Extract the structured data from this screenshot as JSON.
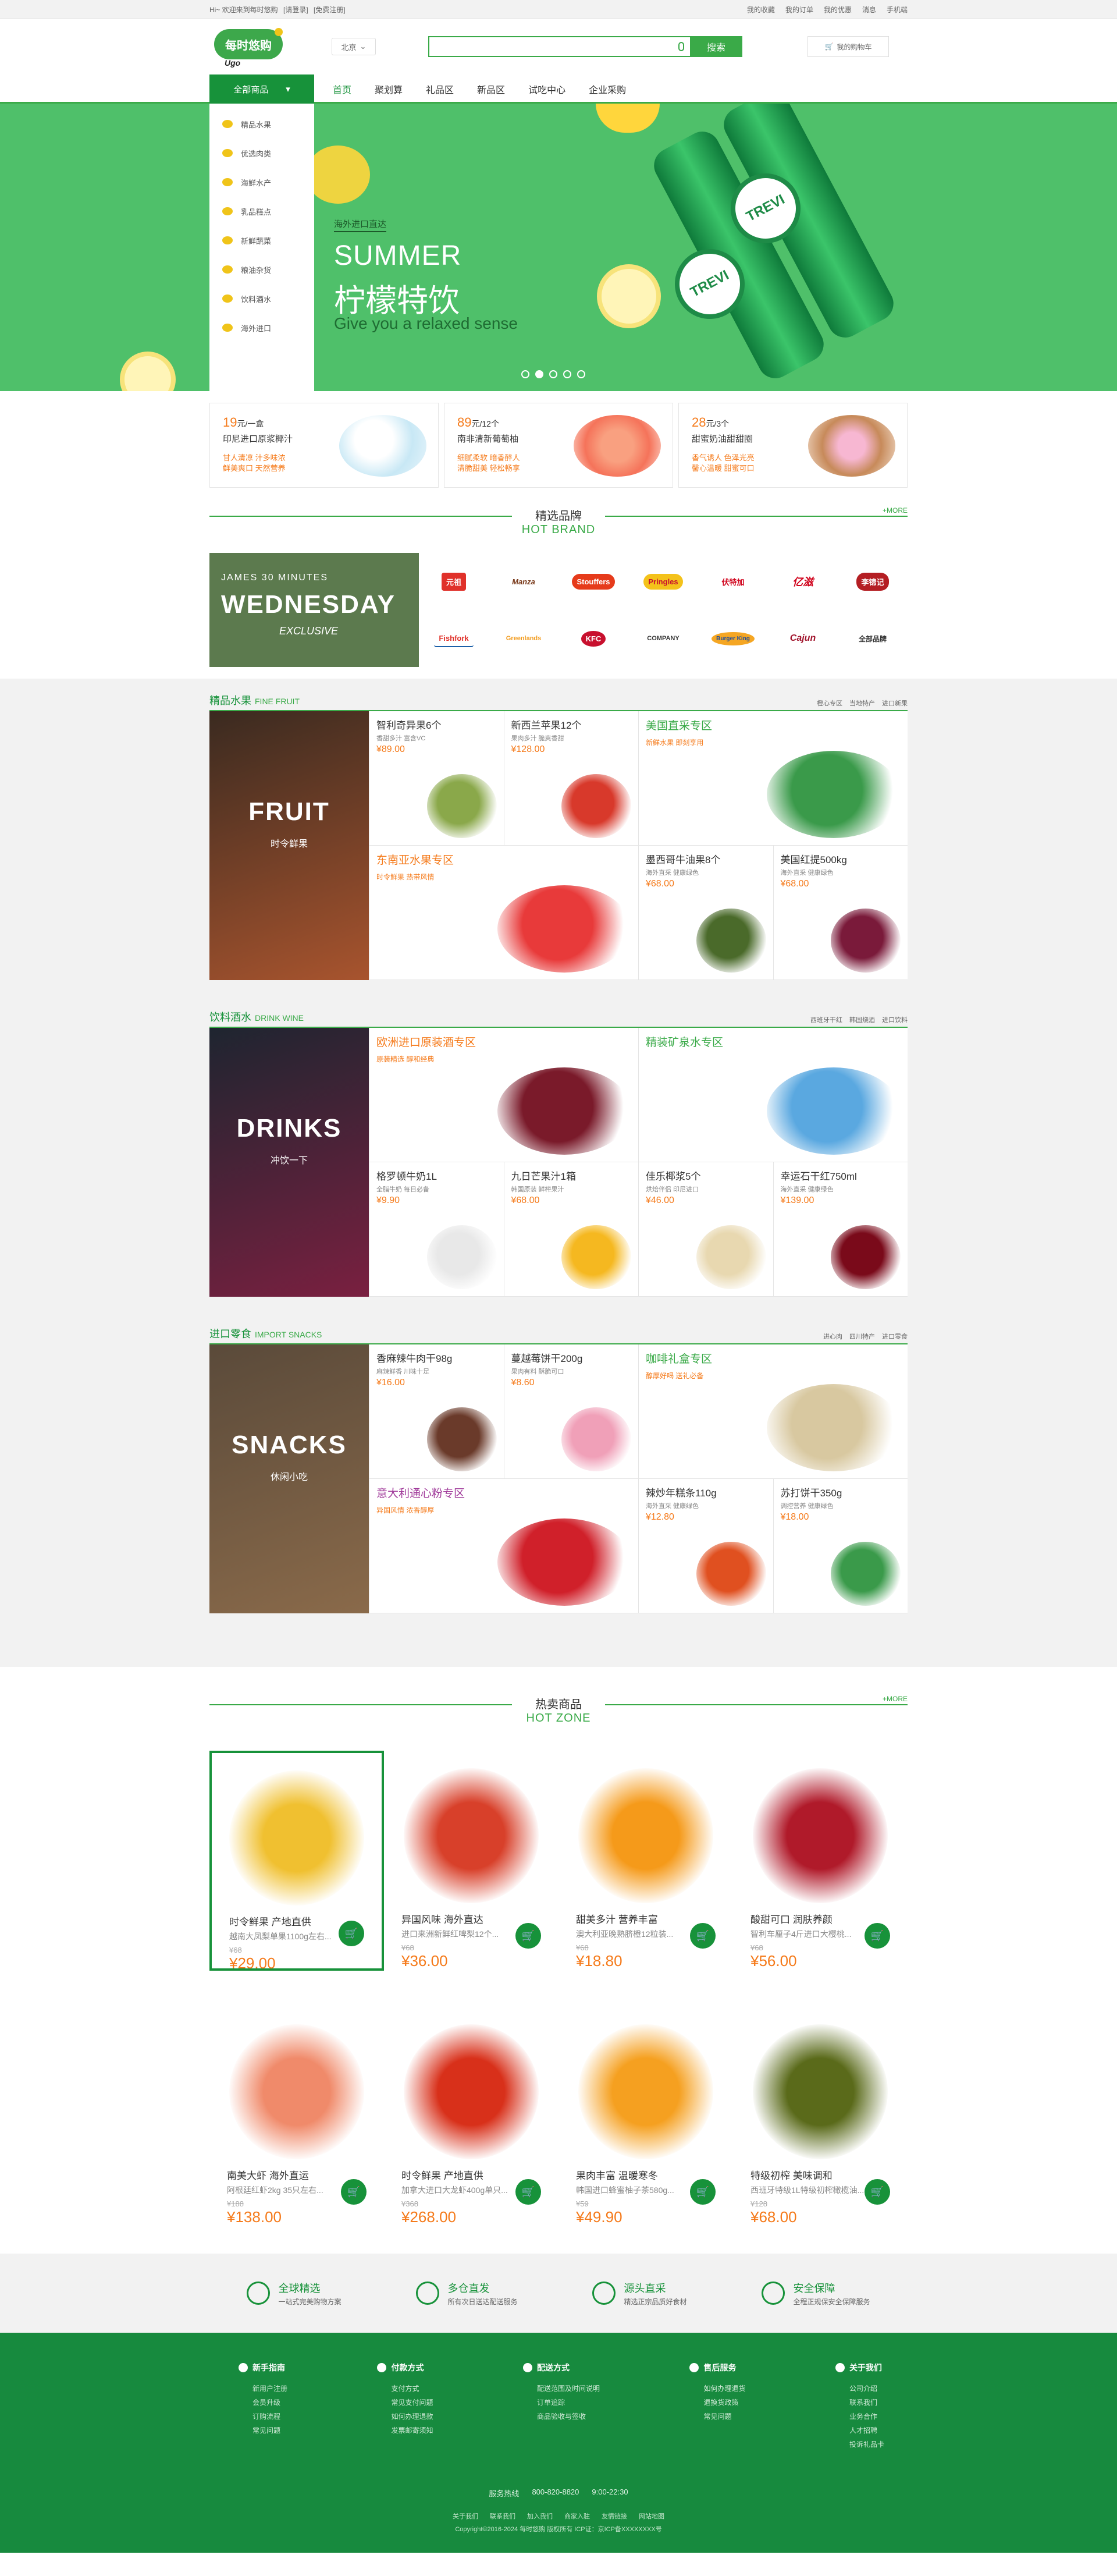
{
  "topbar": {
    "welcome": "Hi~ 欢迎来到每时悠购",
    "login": "[请登录]",
    "register": "[免费注册]",
    "links": [
      "我的收藏",
      "我的订单",
      "我的优惠",
      "消息",
      "手机端"
    ]
  },
  "header": {
    "logo_cn": "每时悠购",
    "logo_en": "Ugo",
    "city": "北京",
    "search_placeholder": "",
    "search_button": "搜索",
    "cart": "我的购物车"
  },
  "nav": {
    "all_label": "全部商品",
    "links": [
      "首页",
      "聚划算",
      "礼品区",
      "新品区",
      "试吃中心",
      "企业采购"
    ]
  },
  "sidebar": {
    "items": [
      "精品水果",
      "优选肉类",
      "海鲜水产",
      "乳品糕点",
      "新鲜蔬菜",
      "粮油杂货",
      "饮料酒水",
      "海外进口"
    ]
  },
  "banner": {
    "tag": "海外进口直达",
    "title_en": "SUMMER",
    "title_cn": "柠檬特饮",
    "subtitle": "Give you a relaxed sense",
    "bottle_label": "TREVI",
    "dots": 5,
    "active_dot": 2
  },
  "promos": [
    {
      "price": "19",
      "unit": "元/一盒",
      "name": "印尼进口原浆椰汁",
      "desc1": "甘人清凉 汁多味浓",
      "desc2": "鲜美爽口 天然营养"
    },
    {
      "price": "89",
      "unit": "元/12个",
      "name": "南非清新葡萄柚",
      "desc1": "细腻柔软 暗香醉人",
      "desc2": "清脆甜美 轻松畅享"
    },
    {
      "price": "28",
      "unit": "元/3个",
      "name": "甜蜜奶油甜甜圈",
      "desc1": "香气诱人 色泽光亮",
      "desc2": "馨心温暖 甜蜜可口"
    }
  ],
  "brand_section": {
    "title_cn": "精选品牌",
    "title_en": "HOT BRAND",
    "more": "+MORE",
    "promo": {
      "line1": "JAMES 30 MINUTES",
      "line2": "WEDNESDAY",
      "line3": "EXCLUSIVE"
    },
    "brands": [
      "元祖",
      "Manza",
      "Stouffers",
      "Pringles",
      "伏特加",
      "亿滋",
      "李锦记",
      "Fishfork",
      "Greenlands",
      "KFC",
      "COMPANY",
      "Burger King",
      "Cajun",
      "全部品牌"
    ]
  },
  "categories": [
    {
      "title": "精品水果",
      "title_en": "FINE FRUIT",
      "tags": [
        "橙心专区",
        "当地特产",
        "进口新果"
      ],
      "banner_big": "FRUIT",
      "banner_small": "时令鲜果",
      "cells": [
        {
          "type": "product",
          "name": "智利奇异果6个",
          "desc": "香甜多汁 富含VC",
          "price": "¥89.00"
        },
        {
          "type": "product",
          "name": "新西兰苹果12个",
          "desc": "果肉多汁 脆爽香甜",
          "price": "¥128.00"
        },
        {
          "type": "zone",
          "name": "美国直采专区",
          "desc": "新鲜水果 即刻享用"
        },
        {
          "type": "zone",
          "name": "东南亚水果专区",
          "desc": "时令鲜果 热带风情"
        },
        {
          "type": "product",
          "name": "墨西哥牛油果8个",
          "desc": "海外直采 健康绿色",
          "price": "¥68.00"
        },
        {
          "type": "product",
          "name": "美国红提500kg",
          "desc": "海外直采 健康绿色",
          "price": "¥68.00"
        }
      ]
    },
    {
      "title": "饮料酒水",
      "title_en": "DRINK WINE",
      "tags": [
        "西班牙干红",
        "韩国烧酒",
        "进口饮料"
      ],
      "banner_big": "DRINKS",
      "banner_small": "冲饮一下",
      "cells": [
        {
          "type": "zone",
          "name": "欧洲进口原装酒专区",
          "desc": "原装精选 醇和经典"
        },
        {
          "type": "zone",
          "name": "精装矿泉水专区",
          "desc": ""
        },
        {
          "type": "product",
          "name": "格罗顿牛奶1L",
          "desc": "全脂牛奶 每日必备",
          "price": "¥9.90"
        },
        {
          "type": "product",
          "name": "九日芒果汁1箱",
          "desc": "韩国原装 鲜榨果汁",
          "price": "¥68.00"
        },
        {
          "type": "product",
          "name": "佳乐椰浆5个",
          "desc": "烘焙伴侣 印尼进口",
          "price": "¥46.00"
        },
        {
          "type": "product",
          "name": "幸运石干红750ml",
          "desc": "海外直采 健康绿色",
          "price": "¥139.00"
        }
      ]
    },
    {
      "title": "进口零食",
      "title_en": "IMPORT SNACKS",
      "tags": [
        "进心肉",
        "四川特产",
        "进口零食"
      ],
      "banner_big": "SNACKS",
      "banner_small": "休闲小吃",
      "cells": [
        {
          "type": "product",
          "name": "香麻辣牛肉干98g",
          "desc": "麻辣鲜香 川味十足",
          "price": "¥16.00"
        },
        {
          "type": "product",
          "name": "蔓越莓饼干200g",
          "desc": "果肉有料 酥脆可口",
          "price": "¥8.60"
        },
        {
          "type": "zone",
          "name": "咖啡礼盒专区",
          "desc": "醇厚好喝 送礼必备"
        },
        {
          "type": "zone",
          "name": "意大利通心粉专区",
          "desc": "异国风情 浓香醇厚"
        },
        {
          "type": "product",
          "name": "辣炒年糕条110g",
          "desc": "海外直采 健康绿色",
          "price": "¥12.80"
        },
        {
          "type": "product",
          "name": "苏打饼干350g",
          "desc": "调控营养 健康绿色",
          "price": "¥18.00"
        }
      ]
    }
  ],
  "hot_section": {
    "title_cn": "热卖商品",
    "title_en": "HOT ZONE",
    "more": "+MORE",
    "items": [
      {
        "name": "时令鲜果 产地直供",
        "desc": "越南大凤梨单果1100g左右...",
        "old": "¥68",
        "price": "¥29.00"
      },
      {
        "name": "异国风味 海外直达",
        "desc": "进口来洲新鲜红啤梨12个...",
        "old": "¥68",
        "price": "¥36.00"
      },
      {
        "name": "甜美多汁 营养丰富",
        "desc": "澳大利亚晚熟脐橙12粒装...",
        "old": "¥68",
        "price": "¥18.80"
      },
      {
        "name": "酸甜可口 润肤养颜",
        "desc": "智利车厘子4斤进口大樱桃...",
        "old": "¥68",
        "price": "¥56.00"
      },
      {
        "name": "南美大虾 海外直运",
        "desc": "阿根廷红虾2kg 35只左右...",
        "old": "¥188",
        "price": "¥138.00"
      },
      {
        "name": "时令鲜果 产地直供",
        "desc": "加拿大进口大龙虾400g单只...",
        "old": "¥368",
        "price": "¥268.00"
      },
      {
        "name": "果肉丰富 温暖寒冬",
        "desc": "韩国进口蜂蜜柚子茶580g...",
        "old": "¥59",
        "price": "¥49.90"
      },
      {
        "name": "特级初榨 美味调和",
        "desc": "西班牙特级1L特级初榨橄榄油...",
        "old": "¥128",
        "price": "¥68.00"
      }
    ]
  },
  "services": [
    {
      "title": "全球精选",
      "desc": "一站式完美购物方案"
    },
    {
      "title": "多仓直发",
      "desc": "所有次日送达配送服务"
    },
    {
      "title": "源头直采",
      "desc": "精选正宗品质好食材"
    },
    {
      "title": "安全保障",
      "desc": "全程正规保安全保障服务"
    }
  ],
  "footer": {
    "columns": [
      {
        "title": "新手指南",
        "links": [
          "新用户注册",
          "会员升级",
          "订购流程",
          "常见问题"
        ]
      },
      {
        "title": "付款方式",
        "links": [
          "支付方式",
          "常见支付问题",
          "如何办理退款",
          "发票邮寄须知"
        ]
      },
      {
        "title": "配送方式",
        "links": [
          "配送范围及时间说明",
          "订单追踪",
          "商品验收与签收"
        ]
      },
      {
        "title": "售后服务",
        "links": [
          "如何办理退货",
          "退换货政策",
          "常见问题"
        ]
      },
      {
        "title": "关于我们",
        "links": [
          "公司介绍",
          "联系我们",
          "业务合作",
          "人才招聘",
          "投诉礼品卡"
        ]
      }
    ],
    "hotline_label": "服务热线",
    "hotline": "800-820-8820",
    "hours": "9:00-22:30",
    "links": [
      "关于我们",
      "联系我们",
      "加入我们",
      "商家入驻",
      "友情链接",
      "网站地图"
    ],
    "copyright": "Copyright©2016-2024 每时悠购 版权所有 ICP证：京ICP备XXXXXXXX号"
  }
}
